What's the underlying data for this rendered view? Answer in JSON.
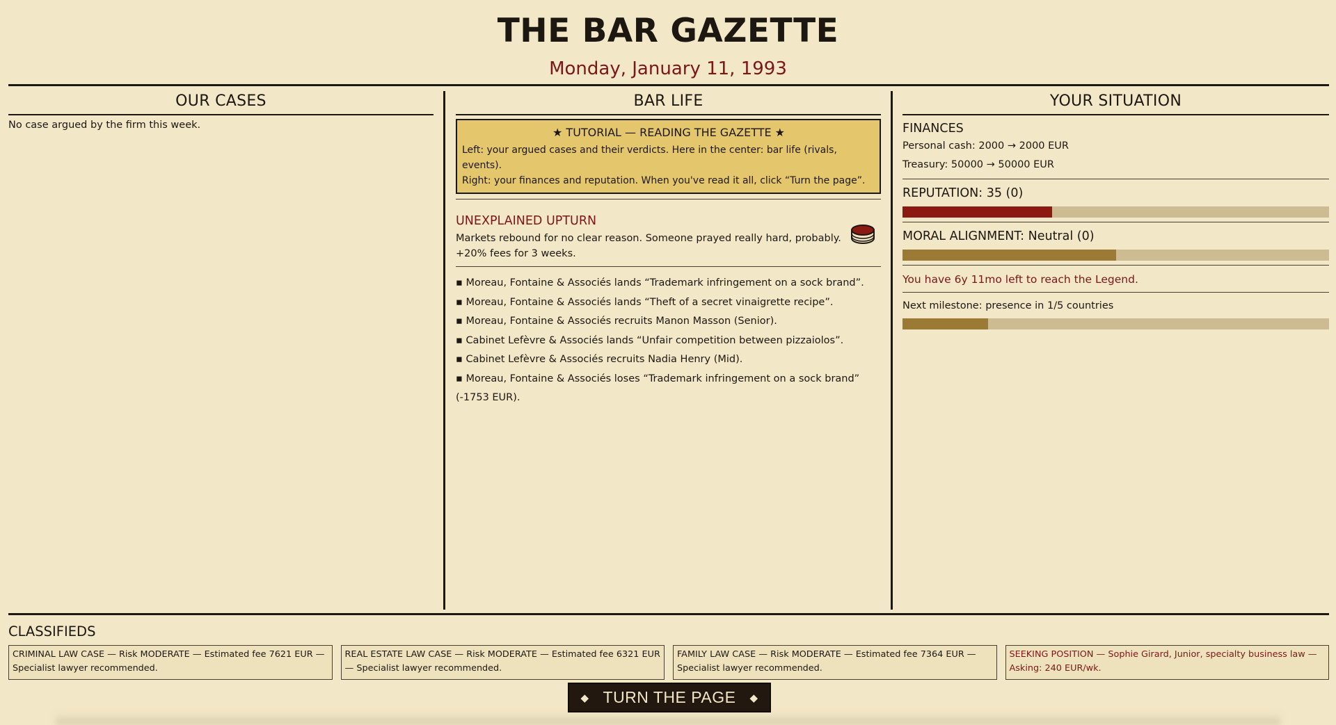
{
  "masthead": {
    "title": "THE BAR GAZETTE",
    "date": "Monday, January 11, 1993"
  },
  "left": {
    "heading": "OUR CASES",
    "empty_note": "No case argued by the firm this week."
  },
  "middle": {
    "heading": "BAR LIFE",
    "tutorial": {
      "title": "★  TUTORIAL — READING THE GAZETTE  ★",
      "line1": "Left: your argued cases and their verdicts. Here in the center: bar life (rivals, events).",
      "line2": "Right: your finances and reputation. When you've read it all, click “Turn the page”."
    },
    "event": {
      "title": "UNEXPLAINED UPTURN",
      "description": "Markets rebound for no clear reason. Someone prayed really hard, probably.",
      "effect": "+20% fees for 3 weeks.",
      "icon": "coin-stack-icon"
    },
    "news": [
      "Moreau, Fontaine & Associés lands “Trademark infringement on a sock brand”.",
      "Moreau, Fontaine & Associés lands “Theft of a secret vinaigrette recipe”.",
      "Moreau, Fontaine & Associés recruits Manon Masson (Senior).",
      "Cabinet Lefèvre & Associés lands “Unfair competition between pizzaiolos”.",
      "Cabinet Lefèvre & Associés recruits Nadia Henry (Mid).",
      "Moreau, Fontaine & Associés loses “Trademark infringement on a sock brand” (-1753 EUR)."
    ]
  },
  "right": {
    "heading": "YOUR SITUATION",
    "finances": {
      "heading": "FINANCES",
      "personal_cash": "Personal cash: 2000 → 2000 EUR",
      "treasury": "Treasury: 50000 → 50000 EUR"
    },
    "reputation": {
      "label": "REPUTATION: 35  (0)",
      "value": 35,
      "max": 100,
      "color": "#8b1a12"
    },
    "moral": {
      "label": "MORAL ALIGNMENT: Neutral (0)",
      "fraction": 0.5,
      "color": "#9a7a35"
    },
    "legend_note": "You have 6y 11mo left to reach the Legend.",
    "milestone": {
      "label": "Next milestone: presence in 1/5 countries",
      "fraction": 0.2,
      "color": "#9a7a35"
    }
  },
  "classifieds": {
    "heading": "CLASSIFIEDS",
    "ads": [
      "CRIMINAL LAW CASE — Risk MODERATE — Estimated fee 7621 EUR — Specialist lawyer recommended.",
      "REAL ESTATE LAW CASE — Risk MODERATE — Estimated fee 6321 EUR — Specialist lawyer recommended.",
      "FAMILY LAW CASE — Risk MODERATE — Estimated fee 7364 EUR — Specialist lawyer recommended.",
      "SEEKING POSITION — Sophie Girard, Junior, specialty business law — Asking: 240 EUR/wk."
    ]
  },
  "turn_button": {
    "label": "TURN THE PAGE",
    "left_glyph": "◆",
    "right_glyph": "◆"
  }
}
